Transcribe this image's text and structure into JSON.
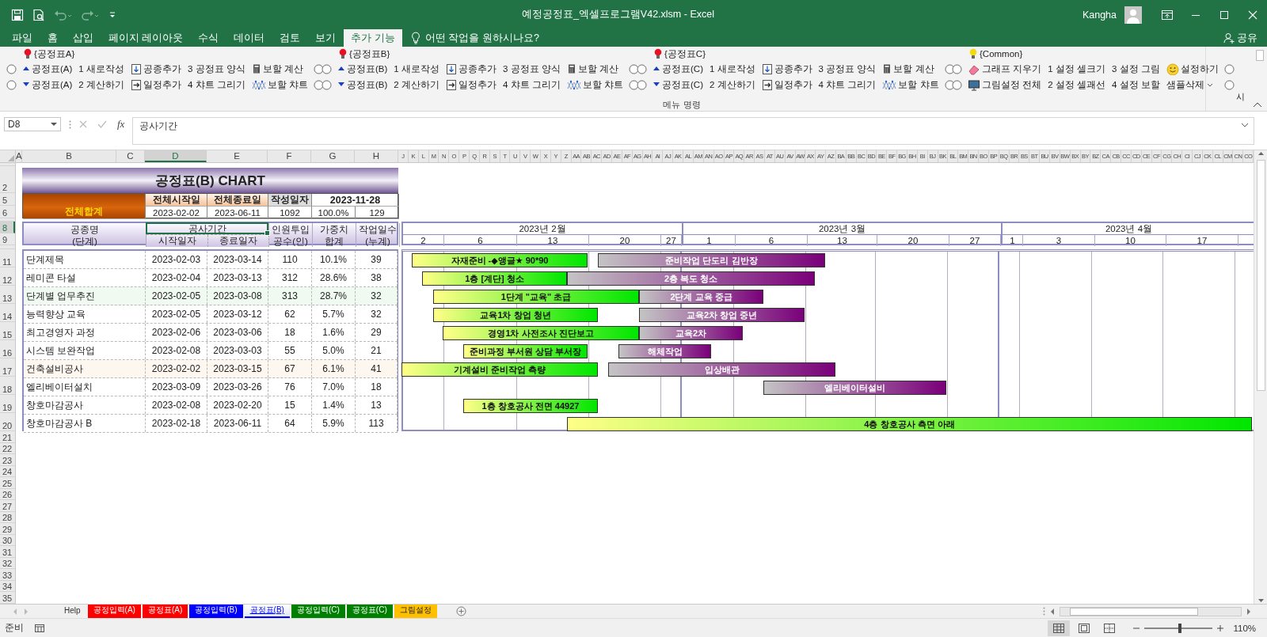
{
  "window": {
    "title": "예정공정표_엑셀프로그램V42.xlsm  -  Excel",
    "user": "Kangha"
  },
  "quick_access": [
    {
      "kind": "save",
      "disabled": false
    },
    {
      "kind": "preview",
      "disabled": false
    },
    {
      "kind": "undo",
      "disabled": true
    },
    {
      "kind": "redo",
      "disabled": true
    },
    {
      "kind": "customize",
      "disabled": false
    }
  ],
  "menu_tabs": [
    {
      "label": "파일",
      "selected": false
    },
    {
      "label": "홈",
      "selected": false
    },
    {
      "label": "삽입",
      "selected": false
    },
    {
      "label": "페이지 레이아웃",
      "selected": false
    },
    {
      "label": "수식",
      "selected": false
    },
    {
      "label": "데이터",
      "selected": false
    },
    {
      "label": "검토",
      "selected": false
    },
    {
      "label": "보기",
      "selected": false
    },
    {
      "label": "추가 기능",
      "selected": true
    }
  ],
  "tell_me": "어떤 작업을 원하시나요?",
  "share": "공유",
  "ribbon": {
    "groups": [
      {
        "title": "{공정표A}",
        "color": "#e81123",
        "rows": [
          [
            {
              "kind": "radio",
              "selected": false
            },
            {
              "kind": "up",
              "label": "공정표(A)"
            },
            {
              "kind": "plain",
              "label": "1 새로작성"
            },
            {
              "kind": "down-box",
              "label": "공종추가"
            },
            {
              "kind": "plain",
              "label": "3 공정표 양식"
            },
            {
              "kind": "calc",
              "label": "보할 계산"
            },
            {
              "kind": "radio",
              "selected": false
            }
          ],
          [
            {
              "kind": "radio",
              "selected": false
            },
            {
              "kind": "down",
              "label": "공정표(A)"
            },
            {
              "kind": "plain",
              "label": "2 계산하기"
            },
            {
              "kind": "right-box",
              "label": "일정추가"
            },
            {
              "kind": "plain",
              "label": "4 챠트 그리기"
            },
            {
              "kind": "chart",
              "label": "보할 챠트"
            },
            {
              "kind": "radio",
              "selected": false
            }
          ]
        ]
      },
      {
        "title": "{공정표B}",
        "color": "#e81123",
        "rows": [
          [
            {
              "kind": "radio",
              "selected": false
            },
            {
              "kind": "up",
              "label": "공정표(B)"
            },
            {
              "kind": "plain",
              "label": "1 새로작성"
            },
            {
              "kind": "down-box",
              "label": "공종추가"
            },
            {
              "kind": "plain",
              "label": "3 공정표 양식"
            },
            {
              "kind": "calc",
              "label": "보할 계산"
            },
            {
              "kind": "radio",
              "selected": false
            }
          ],
          [
            {
              "kind": "radio",
              "selected": false
            },
            {
              "kind": "down",
              "label": "공정표(B)"
            },
            {
              "kind": "plain",
              "label": "2 계산하기"
            },
            {
              "kind": "right-box",
              "label": "일정추가"
            },
            {
              "kind": "plain",
              "label": "4 챠트 그리기"
            },
            {
              "kind": "chart",
              "label": "보할 챠트"
            },
            {
              "kind": "radio",
              "selected": false
            }
          ]
        ]
      },
      {
        "title": "{공정표C}",
        "color": "#e81123",
        "rows": [
          [
            {
              "kind": "radio",
              "selected": false
            },
            {
              "kind": "up",
              "label": "공정표(C)"
            },
            {
              "kind": "plain",
              "label": "1 새로작성"
            },
            {
              "kind": "down-box",
              "label": "공종추가"
            },
            {
              "kind": "plain",
              "label": "3 공정표 양식"
            },
            {
              "kind": "calc",
              "label": "보할 계산"
            },
            {
              "kind": "radio",
              "selected": false
            }
          ],
          [
            {
              "kind": "radio",
              "selected": false
            },
            {
              "kind": "down",
              "label": "공정표(C)"
            },
            {
              "kind": "plain",
              "label": "2 계산하기"
            },
            {
              "kind": "right-box",
              "label": "일정추가"
            },
            {
              "kind": "plain",
              "label": "4 챠트 그리기"
            },
            {
              "kind": "chart",
              "label": "보할 챠트"
            },
            {
              "kind": "radio",
              "selected": false
            }
          ]
        ]
      },
      {
        "title": "{Common}",
        "color": "#f5d90a",
        "rows": [
          [
            {
              "kind": "radio",
              "selected": false
            },
            {
              "kind": "eraser",
              "label": "그래프 지우기"
            },
            {
              "kind": "plain",
              "label": "1 설정 셀크기"
            },
            {
              "kind": "plain",
              "label": "3 설정 그림"
            },
            {
              "kind": "smiley",
              "label": "설정하기"
            },
            {
              "kind": "radio",
              "selected": false
            }
          ],
          [
            {
              "kind": "radio",
              "selected": false
            },
            {
              "kind": "monitor",
              "label": "그림설정 전체"
            },
            {
              "kind": "plain",
              "label": "2 설정 셀괘선"
            },
            {
              "kind": "plain",
              "label": "4 설정 보할"
            },
            {
              "kind": "dropdown",
              "label": "샘플삭제"
            },
            {
              "kind": "radio",
              "selected": false
            }
          ]
        ]
      }
    ],
    "group_label": "메뉴 명령",
    "cut_label": "시"
  },
  "formula_bar": {
    "name_box": "D8",
    "function_label": "fx",
    "value": "공사기간"
  },
  "columns": [
    {
      "label": "A",
      "selected": false
    },
    {
      "label": "B",
      "selected": false
    },
    {
      "label": "C",
      "selected": false
    },
    {
      "label": "D",
      "selected": true
    },
    {
      "label": "E",
      "selected": false
    },
    {
      "label": "F",
      "selected": false
    },
    {
      "label": "G",
      "selected": false
    },
    {
      "label": "H",
      "selected": false
    }
  ],
  "narrow_columns": [
    "J",
    "K",
    "L",
    "M",
    "N",
    "O",
    "P",
    "Q",
    "R",
    "S",
    "T",
    "U",
    "V",
    "W",
    "X",
    "Y",
    "Z",
    "AA",
    "AB",
    "AC",
    "AD",
    "AE",
    "AF",
    "AG",
    "AH",
    "AI",
    "AJ",
    "AK",
    "AL",
    "AM",
    "AN",
    "AO",
    "AP",
    "AQ",
    "AR",
    "AS",
    "AT",
    "AU",
    "AV",
    "AW",
    "AX",
    "AY",
    "AZ",
    "BA",
    "BB",
    "BC",
    "BD",
    "BE",
    "BF",
    "BG",
    "BH",
    "BI",
    "BJ",
    "BK",
    "BL",
    "BM",
    "BN",
    "BO",
    "BP",
    "BQ",
    "BR",
    "BS",
    "BT",
    "BU",
    "BV",
    "BW",
    "BX",
    "BY",
    "BZ",
    "CA",
    "CB",
    "CC",
    "CD",
    "CE",
    "CF",
    "CG",
    "CH",
    "CI",
    "CJ",
    "CK",
    "CL",
    "CM",
    "CN",
    "CO"
  ],
  "row_headers": [
    {
      "label": "2",
      "selected": false
    },
    {
      "label": "5",
      "selected": false
    },
    {
      "label": "6",
      "selected": false
    },
    {
      "label": "8",
      "selected": true
    },
    {
      "label": "9",
      "selected": false
    },
    {
      "label": "11",
      "selected": false
    },
    {
      "label": "12",
      "selected": false
    },
    {
      "label": "13",
      "selected": false
    },
    {
      "label": "14",
      "selected": false
    },
    {
      "label": "15",
      "selected": false
    },
    {
      "label": "16",
      "selected": false
    },
    {
      "label": "17",
      "selected": false
    },
    {
      "label": "18",
      "selected": false
    },
    {
      "label": "19",
      "selected": false
    },
    {
      "label": "20",
      "selected": false
    },
    {
      "label": "21",
      "selected": false
    },
    {
      "label": "22",
      "selected": false
    },
    {
      "label": "23",
      "selected": false
    },
    {
      "label": "24",
      "selected": false
    },
    {
      "label": "25",
      "selected": false
    },
    {
      "label": "26",
      "selected": false
    },
    {
      "label": "27",
      "selected": false
    },
    {
      "label": "28",
      "selected": false
    },
    {
      "label": "29",
      "selected": false
    },
    {
      "label": "30",
      "selected": false
    },
    {
      "label": "31",
      "selected": false
    },
    {
      "label": "32",
      "selected": false
    },
    {
      "label": "33",
      "selected": false
    },
    {
      "label": "34",
      "selected": false
    },
    {
      "label": "35",
      "selected": false
    }
  ],
  "sheet": {
    "title": "공정표(B) CHART",
    "summary": {
      "label": "전체합계",
      "headers": [
        "전체시작일",
        "전체종료일",
        "작성일자"
      ],
      "date": "2023-11-28",
      "values": [
        "2023-02-02",
        "2023-06-11",
        "1092",
        "100.0%",
        "129"
      ]
    },
    "header": {
      "name": [
        "공종명",
        "(단계)"
      ],
      "period": "공사기간",
      "period_selected": true,
      "start": "시작일자",
      "end": "종료일자",
      "columns": [
        [
          "인원투입",
          "공수(인)"
        ],
        [
          "가중치",
          "합계"
        ],
        [
          "작업일수",
          "(누계)"
        ]
      ]
    },
    "rows": [
      {
        "name": "단계제목",
        "start": "2023-02-03",
        "end": "2023-03-14",
        "workers": "110",
        "weight": "10.1%",
        "days": "39",
        "color": "#ffffff"
      },
      {
        "name": "레미콘 타설",
        "start": "2023-02-04",
        "end": "2023-03-13",
        "workers": "312",
        "weight": "28.6%",
        "days": "38",
        "color": "#ffffff"
      },
      {
        "name": "단계별 업무추진",
        "start": "2023-02-05",
        "end": "2023-03-08",
        "workers": "313",
        "weight": "28.7%",
        "days": "32",
        "color": "#f1faf1"
      },
      {
        "name": "능력향상 교육",
        "start": "2023-02-05",
        "end": "2023-03-12",
        "workers": "62",
        "weight": "5.7%",
        "days": "32",
        "color": "#ffffff"
      },
      {
        "name": "최고경영자 과정",
        "start": "2023-02-06",
        "end": "2023-03-06",
        "workers": "18",
        "weight": "1.6%",
        "days": "29",
        "color": "#ffffff"
      },
      {
        "name": "시스템 보완작업",
        "start": "2023-02-08",
        "end": "2023-03-03",
        "workers": "55",
        "weight": "5.0%",
        "days": "21",
        "color": "#ffffff"
      },
      {
        "name": "건축설비공사",
        "start": "2023-02-02",
        "end": "2023-03-15",
        "workers": "67",
        "weight": "6.1%",
        "days": "41",
        "color": "#fdf7f0"
      },
      {
        "name": "엘리베이터설치",
        "start": "2023-03-09",
        "end": "2023-03-26",
        "workers": "76",
        "weight": "7.0%",
        "days": "18",
        "color": "#ffffff"
      },
      {
        "name": "창호마감공사",
        "start": "2023-02-08",
        "end": "2023-02-20",
        "workers": "15",
        "weight": "1.4%",
        "days": "13",
        "color": "#ffffff"
      },
      {
        "name": "창호마감공사 B",
        "start": "2023-02-18",
        "end": "2023-06-11",
        "workers": "64",
        "weight": "5.9%",
        "days": "113",
        "color": "#ffffff"
      }
    ]
  },
  "gantt": {
    "months": [
      {
        "label": "2023년 2월",
        "days": [
          "2",
          "6",
          "13",
          "20",
          "27"
        ]
      },
      {
        "label": "2023년 3월",
        "days": [
          "1",
          "6",
          "13",
          "20",
          "27"
        ]
      },
      {
        "label": "2023년 4월",
        "days": [
          "1",
          "3",
          "10",
          "17"
        ]
      }
    ],
    "rows": [
      {
        "bars": [
          {
            "kind": "green",
            "label": "자재준비 -◆앵글★ 90*90"
          },
          {
            "kind": "purple",
            "label": "준비작업 단도리 김반장"
          }
        ]
      },
      {
        "bars": [
          {
            "kind": "green",
            "label": "1층 [계단] 청소"
          },
          {
            "kind": "purple",
            "label": "2층 복도 청소"
          }
        ]
      },
      {
        "bars": [
          {
            "kind": "green",
            "label": "1단계 \"교육\" 초급"
          },
          {
            "kind": "purple",
            "label": "2단계 교육 중급"
          }
        ]
      },
      {
        "bars": [
          {
            "kind": "green",
            "label": "교육1차 창업 청년"
          },
          {
            "kind": "purple",
            "label": "교육2차 창업 중년"
          }
        ]
      },
      {
        "bars": [
          {
            "kind": "green",
            "label": "경영1차 사전조사 진단보고"
          },
          {
            "kind": "purple",
            "label": "교육2차"
          }
        ]
      },
      {
        "bars": [
          {
            "kind": "green",
            "label": "준비과정 부서원 상담 부서장"
          },
          {
            "kind": "purple",
            "label": "해체작업"
          }
        ]
      },
      {
        "bars": [
          {
            "kind": "green",
            "label": "기계설비 준비작업 측량"
          },
          {
            "kind": "purple",
            "label": "입상배관"
          }
        ]
      },
      {
        "bars": [
          {
            "kind": "purple",
            "label": "엘리베이터설비"
          }
        ]
      },
      {
        "bars": [
          {
            "kind": "green",
            "label": "1층 창호공사 전면 44927"
          }
        ]
      },
      {
        "bars": [
          {
            "kind": "green",
            "label": "4층 창호공사 측면 아래"
          }
        ]
      }
    ]
  },
  "sheet_tabs": [
    {
      "label": "Help",
      "selected": false
    },
    {
      "label": "공정입력(A)",
      "selected": false,
      "color": "#ff0000"
    },
    {
      "label": "공정표(A)",
      "selected": false,
      "color": "#ff0000"
    },
    {
      "label": "공정입력(B)",
      "selected": false,
      "color": "#0000ff"
    },
    {
      "label": "공정표(B)",
      "selected": true,
      "color": "#0000ff"
    },
    {
      "label": "공정입력(C)",
      "selected": false,
      "color": "#008000"
    },
    {
      "label": "공정표(C)",
      "selected": false,
      "color": "#008000"
    },
    {
      "label": "그림설정",
      "selected": false,
      "color": "#ffc000"
    }
  ],
  "status": {
    "text": "준비",
    "views": [
      {
        "kind": "normal",
        "selected": true
      },
      {
        "kind": "page-layout",
        "selected": false
      },
      {
        "kind": "page-break",
        "selected": false
      }
    ],
    "zoom": {
      "level": 0.52,
      "label": "110%"
    }
  }
}
